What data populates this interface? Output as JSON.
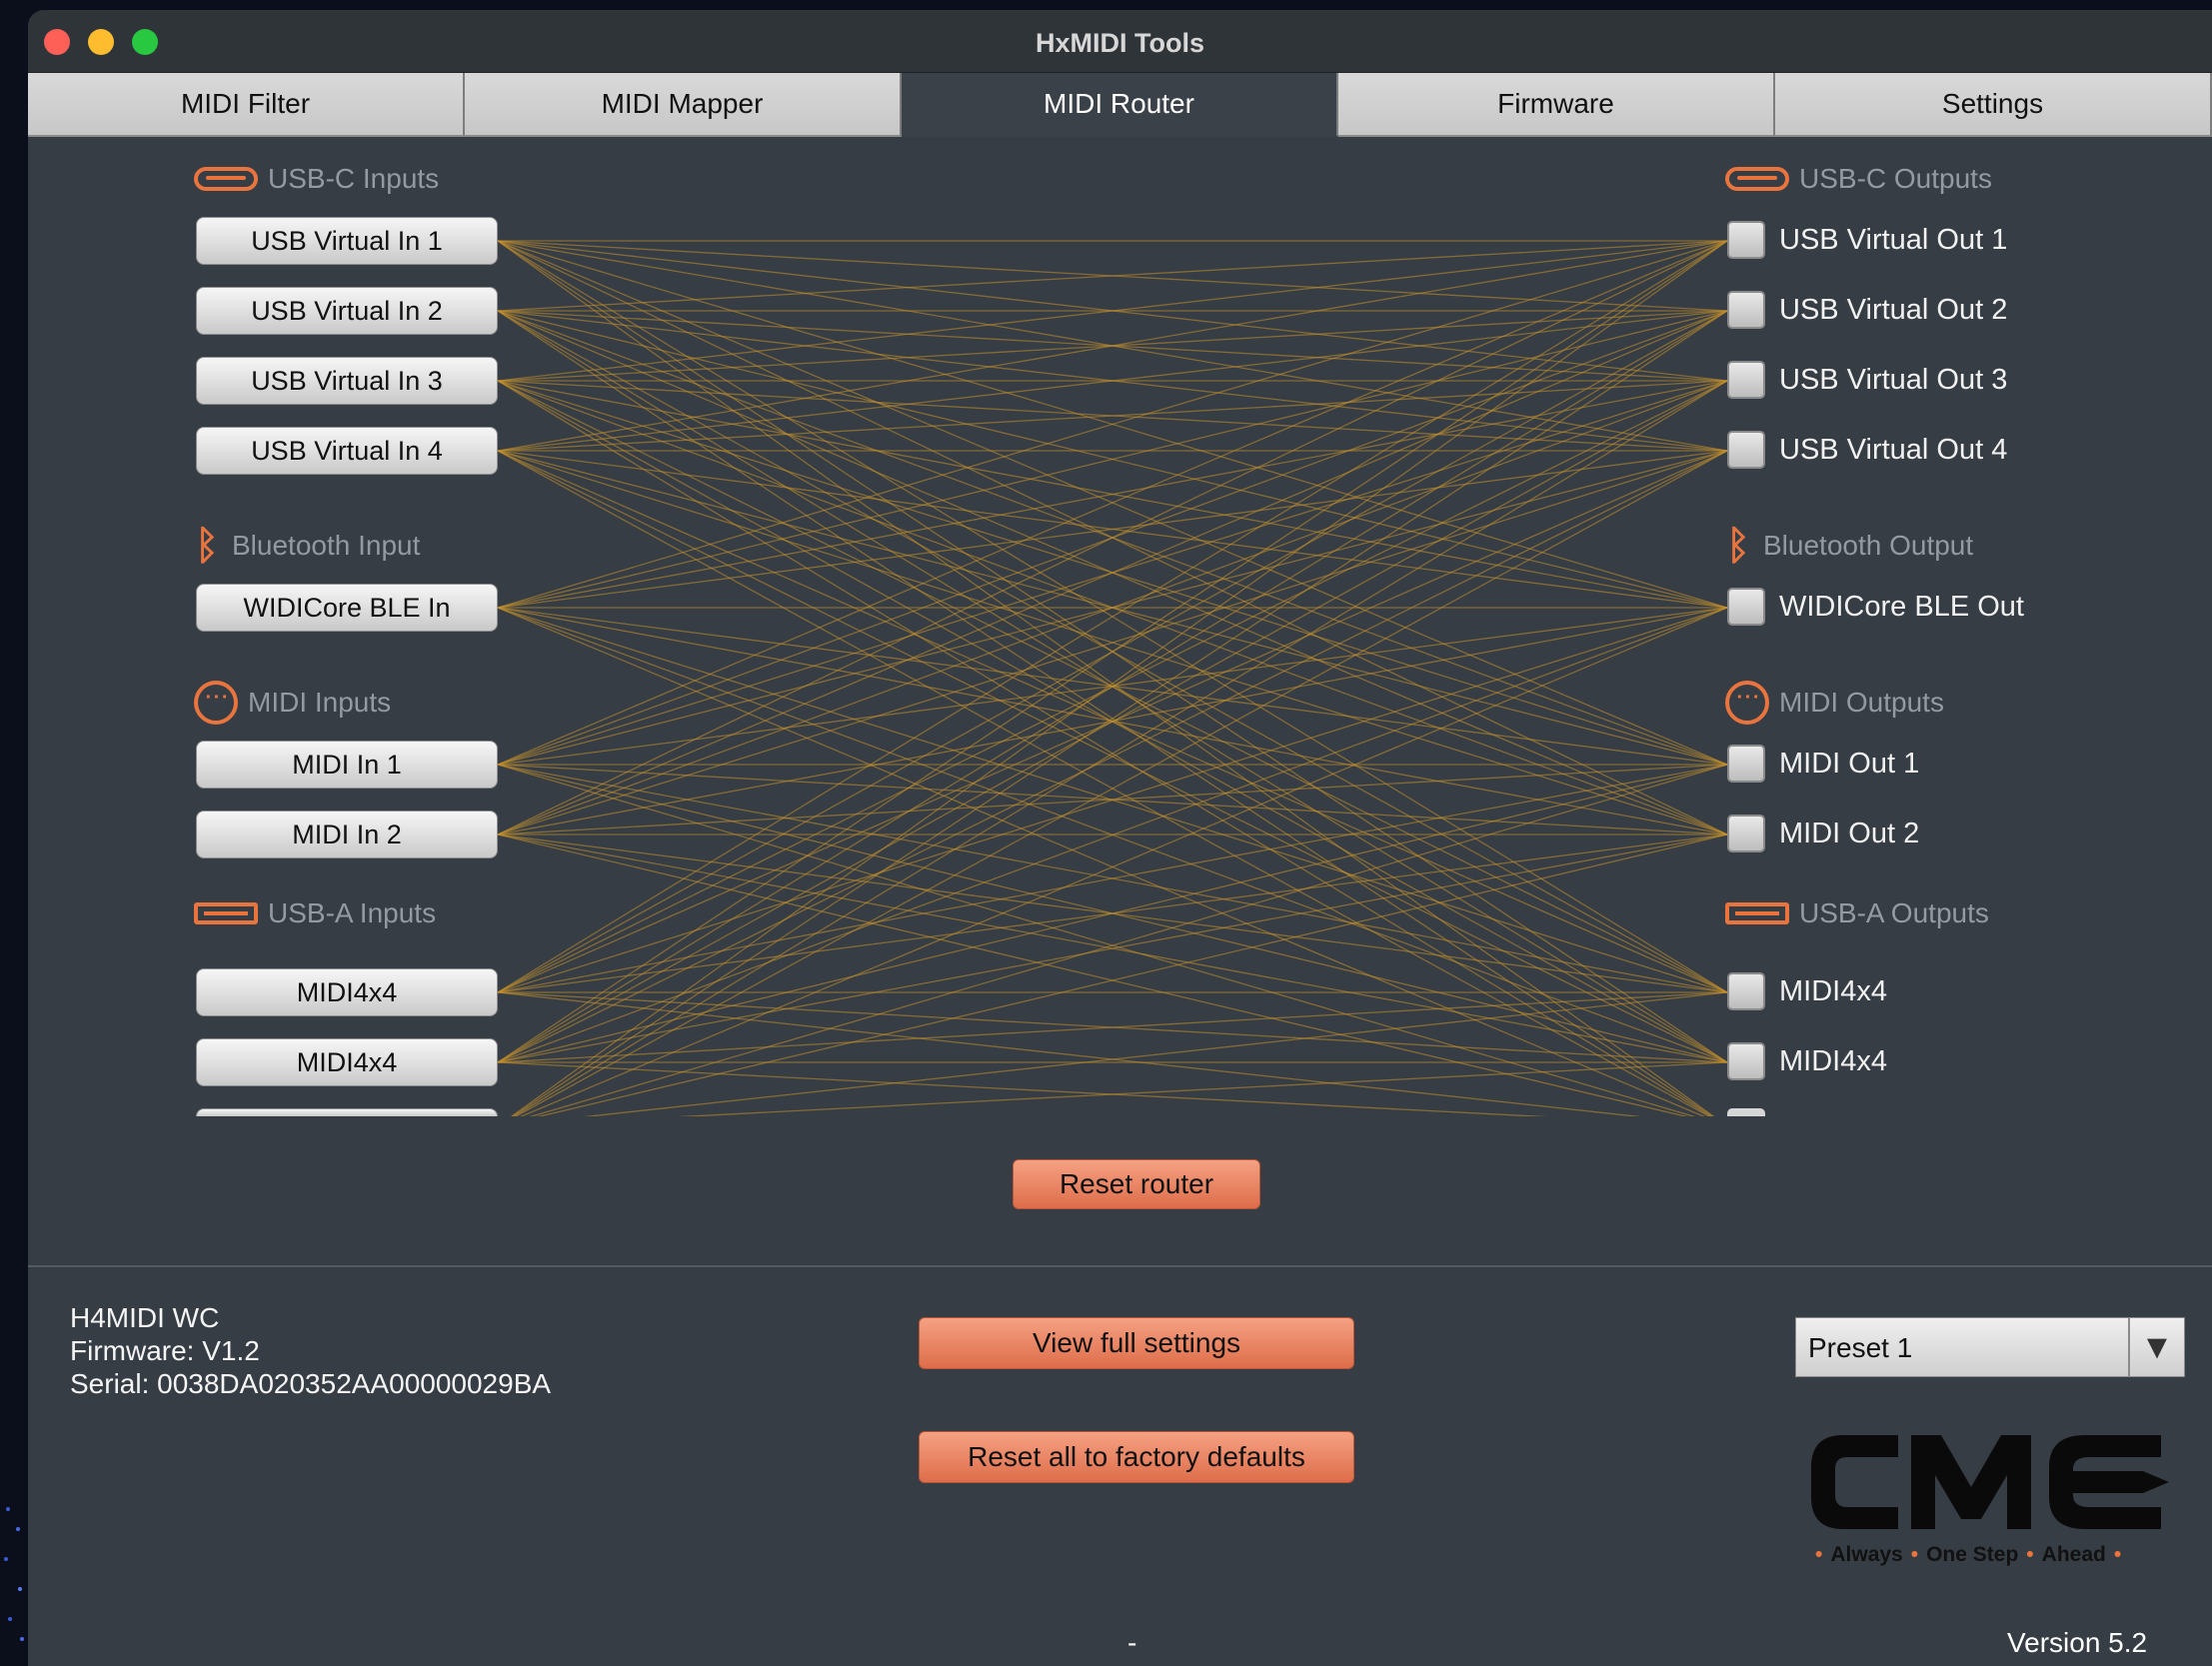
{
  "window": {
    "title": "HxMIDI Tools"
  },
  "tabs": [
    {
      "label": "MIDI Filter",
      "active": false
    },
    {
      "label": "MIDI Mapper",
      "active": false
    },
    {
      "label": "MIDI Router",
      "active": true
    },
    {
      "label": "Firmware",
      "active": false
    },
    {
      "label": "Settings",
      "active": false
    }
  ],
  "inputs": {
    "usbc_label": "USB-C Inputs",
    "usbc": [
      "USB Virtual In 1",
      "USB Virtual In 2",
      "USB Virtual In 3",
      "USB Virtual In 4"
    ],
    "bt_label": "Bluetooth Input",
    "bt": [
      "WIDICore BLE In"
    ],
    "midi_label": "MIDI Inputs",
    "midi": [
      "MIDI In 1",
      "MIDI In 2"
    ],
    "usba_label": "USB-A Inputs",
    "usba": [
      "MIDI4x4",
      "MIDI4x4"
    ]
  },
  "outputs": {
    "usbc_label": "USB-C Outputs",
    "usbc": [
      "USB Virtual Out 1",
      "USB Virtual Out 2",
      "USB Virtual Out 3",
      "USB Virtual Out 4"
    ],
    "bt_label": "Bluetooth Output",
    "bt": [
      "WIDICore BLE Out"
    ],
    "midi_label": "MIDI Outputs",
    "midi": [
      "MIDI Out 1",
      "MIDI Out 2"
    ],
    "usba_label": "USB-A Outputs",
    "usba": [
      "MIDI4x4",
      "MIDI4x4"
    ]
  },
  "buttons": {
    "reset_router": "Reset router",
    "view_full_settings": "View full settings",
    "reset_factory": "Reset all to factory defaults"
  },
  "device": {
    "name": "H4MIDI WC",
    "firmware": "Firmware: V1.2",
    "serial": "Serial: 0038DA020352AA00000029BA"
  },
  "preset": {
    "value": "Preset 1"
  },
  "brand": {
    "logo_text": "CME",
    "tagline": [
      "Always",
      "One",
      "Step",
      "Ahead"
    ]
  },
  "footer": {
    "center": "-",
    "version": "Version 5.2"
  },
  "colors": {
    "accent": "#e9743d",
    "wire": "#c6922c",
    "panel": "#363d45"
  },
  "icons": {
    "usb_c": "usb-c-icon",
    "bluetooth": "bluetooth-icon",
    "midi": "midi-din-icon",
    "usb_a": "usb-a-icon"
  }
}
